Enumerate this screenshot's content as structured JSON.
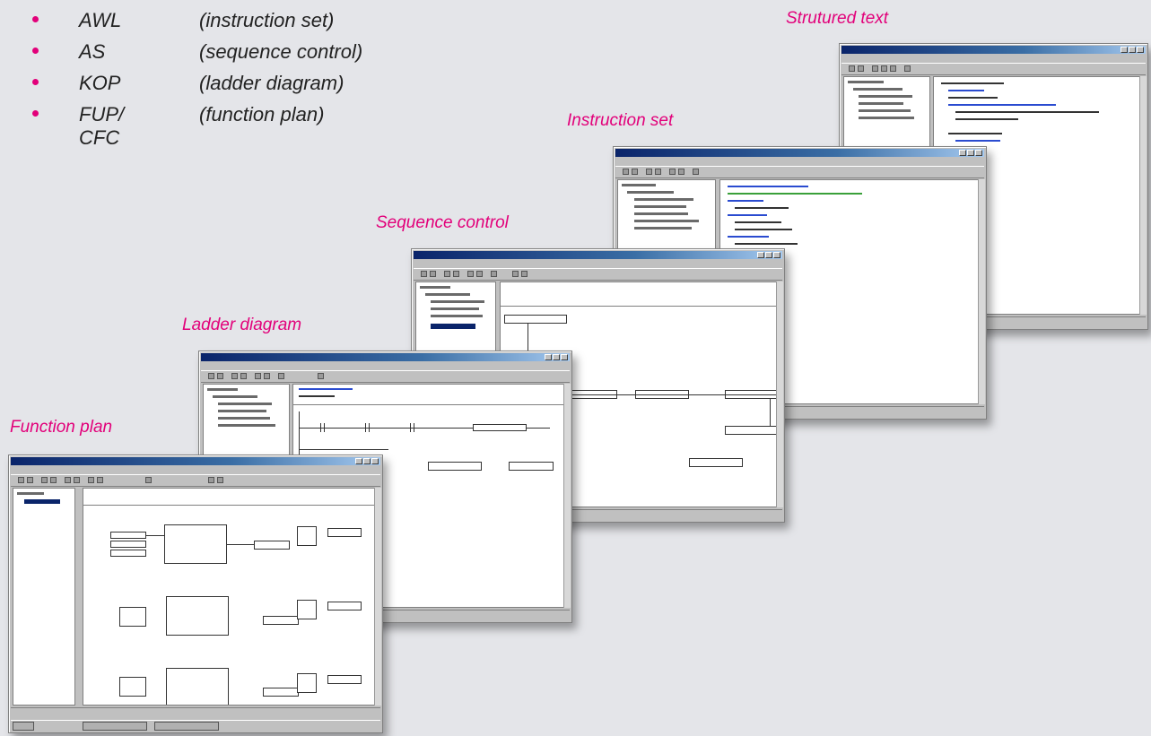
{
  "languages": [
    {
      "term": "AWL",
      "desc": "(instruction set)"
    },
    {
      "term": "AS",
      "desc": "(sequence control)"
    },
    {
      "term": "KOP",
      "desc": "(ladder diagram)"
    },
    {
      "term": "FUP/ CFC",
      "desc": "(function plan)"
    }
  ],
  "captions": {
    "structured_text": "Strutured text",
    "instruction_set": "Instruction set",
    "sequence_control": "Sequence control",
    "ladder_diagram": "Ladder diagram",
    "function_plan": "Function plan"
  },
  "colors": {
    "accent": "#e2007a",
    "titlebar": "#0a246a",
    "window": "#c0c0c0",
    "background": "#e4e5e9"
  }
}
